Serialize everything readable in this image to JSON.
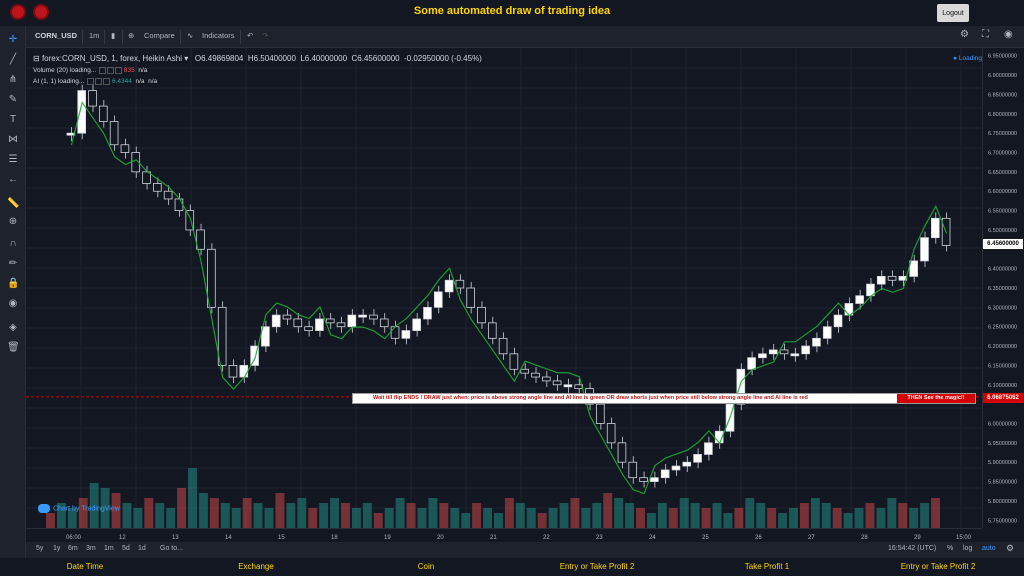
{
  "app": {
    "title": "Some automated draw of trading idea",
    "logout_label": "Logout"
  },
  "toolbar": {
    "symbol": "CORN_USD",
    "interval": "1m",
    "compare_label": "Compare",
    "indicators_label": "Indicators"
  },
  "legend": {
    "main": "forex:CORN_USD, 1, forex, Heikin Ashi",
    "open": "O6.49869804",
    "high": "H6.50400000",
    "low": "L6.40000000",
    "close": "C6.45600000",
    "change": "-0.02950000 (-0.45%)",
    "volume_label": "Volume (20) loading...",
    "volume_value": "835",
    "volume_na": "n/a",
    "ai_label": "AI (1, 1) loading...",
    "ai_value": "6.4344",
    "ai_na1": "n/a",
    "ai_na2": "n/a",
    "loading": "Loading"
  },
  "banner": {
    "text": "Wait till flip ENDS  !   DRAW just when:  price is above strong angle line and AI line is green          OR          draw shorts just when price still below strong angle line and AI line is red",
    "right": "THEN See the magic!!"
  },
  "prices": {
    "current": "6.45600000",
    "line": "6.06875062"
  },
  "price_axis_labels": [
    "6.95000000",
    "6.90000000",
    "6.85000000",
    "6.80000000",
    "6.75000000",
    "6.70000000",
    "6.65000000",
    "6.60000000",
    "6.55000000",
    "6.50000000",
    "6.40000000",
    "6.35000000",
    "6.30000000",
    "6.25000000",
    "6.20000000",
    "6.15000000",
    "6.10000000",
    "6.00000000",
    "5.95000000",
    "5.90000000",
    "5.85000000",
    "5.80000000",
    "5.75000000"
  ],
  "time_axis_labels": [
    "06:00",
    "12",
    "13",
    "14",
    "15",
    "18",
    "19",
    "20",
    "21",
    "22",
    "23",
    "24",
    "25",
    "26",
    "27",
    "28",
    "29",
    "15:00"
  ],
  "bottom_bar": {
    "ranges": [
      "5y",
      "1y",
      "6m",
      "3m",
      "1m",
      "5d",
      "1d"
    ],
    "goto": "Go to...",
    "clock": "16:54:42 (UTC)",
    "percent": "%",
    "log": "log",
    "auto": "auto"
  },
  "watermark": "Chart by TradingView",
  "footer": [
    "Date Time",
    "Exchange",
    "Coin",
    "Entry or Take Profit 2",
    "Take Profit 1",
    "Entry or Take Profit 2"
  ],
  "colors": {
    "accent": "#ffd500",
    "up": "#26a69a",
    "down": "#ef5350",
    "ai_green": "#1faa3a",
    "ai_red": "#d41f1f",
    "background": "#131722"
  },
  "chart_data": {
    "type": "line",
    "style": "heikin-ashi candles",
    "price_path": [
      6.75,
      6.86,
      6.82,
      6.78,
      6.72,
      6.7,
      6.65,
      6.62,
      6.6,
      6.58,
      6.55,
      6.5,
      6.45,
      6.3,
      6.15,
      6.12,
      6.15,
      6.2,
      6.25,
      6.28,
      6.27,
      6.25,
      6.24,
      6.27,
      6.26,
      6.25,
      6.28,
      6.28,
      6.27,
      6.25,
      6.22,
      6.24,
      6.27,
      6.3,
      6.34,
      6.37,
      6.35,
      6.3,
      6.26,
      6.22,
      6.18,
      6.14,
      6.13,
      6.12,
      6.11,
      6.1,
      6.1,
      6.09,
      6.05,
      6.0,
      5.95,
      5.9,
      5.86,
      5.85,
      5.86,
      5.88,
      5.89,
      5.9,
      5.92,
      5.95,
      5.98,
      6.05,
      6.14,
      6.17,
      6.18,
      6.19,
      6.18,
      6.18,
      6.2,
      6.22,
      6.25,
      6.28,
      6.31,
      6.33,
      6.36,
      6.38,
      6.37,
      6.38,
      6.42,
      6.48,
      6.53,
      6.46
    ],
    "ai_line_green_segments": [
      "06:00",
      "13",
      "14-15",
      "20",
      "25-26",
      "27-29"
    ],
    "volume": [
      3,
      5,
      4,
      6,
      9,
      8,
      7,
      5,
      4,
      6,
      5,
      4,
      8,
      12,
      7,
      6,
      5,
      4,
      6,
      5,
      4,
      7,
      5,
      6,
      4,
      5,
      6,
      5,
      4,
      5,
      3,
      4,
      6,
      5,
      4,
      6,
      5,
      4,
      3,
      5,
      4,
      3,
      6,
      5,
      4,
      3,
      4,
      5,
      6,
      4,
      5,
      7,
      6,
      5,
      4,
      3,
      5,
      4,
      6,
      5,
      4,
      5,
      3,
      4,
      6,
      5,
      4,
      3,
      4,
      5,
      6,
      5,
      4,
      3,
      4,
      5,
      4,
      6,
      5,
      4,
      5,
      6
    ],
    "ylim": [
      5.73,
      6.97
    ]
  }
}
